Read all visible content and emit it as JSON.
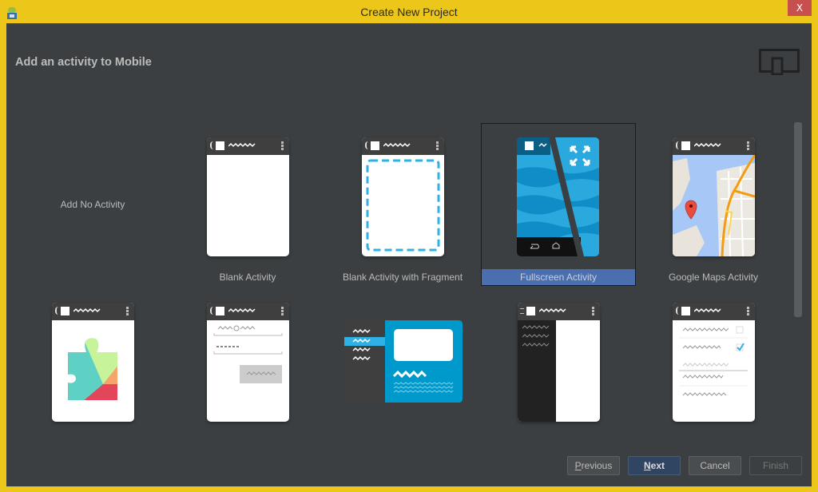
{
  "window": {
    "title": "Create New Project",
    "close_label": "X"
  },
  "page": {
    "heading": "Add an activity to Mobile",
    "device_icon": "phone-tablet-icon"
  },
  "activities": [
    {
      "label": "Add No Activity",
      "preview": "none",
      "selected": false
    },
    {
      "label": "Blank Activity",
      "preview": "blank",
      "selected": false
    },
    {
      "label": "Blank Activity with Fragment",
      "preview": "fragment",
      "selected": false
    },
    {
      "label": "Fullscreen Activity",
      "preview": "fullscreen",
      "selected": true
    },
    {
      "label": "Google Maps Activity",
      "preview": "maps",
      "selected": false
    },
    {
      "label": "",
      "preview": "play-services",
      "selected": false
    },
    {
      "label": "",
      "preview": "login",
      "selected": false
    },
    {
      "label": "",
      "preview": "master-detail",
      "selected": false
    },
    {
      "label": "",
      "preview": "navigation-drawer",
      "selected": false
    },
    {
      "label": "",
      "preview": "settings",
      "selected": false
    }
  ],
  "buttons": {
    "previous": {
      "label": "Previous",
      "mnemonic": "P",
      "rest": "revious",
      "enabled": true
    },
    "next": {
      "label": "Next",
      "mnemonic": "N",
      "rest": "ext",
      "enabled": true
    },
    "cancel": {
      "label": "Cancel",
      "enabled": true
    },
    "finish": {
      "label": "Finish",
      "enabled": false
    }
  },
  "colors": {
    "frame": "#ecc619",
    "background": "#3c3f41",
    "selection": "#4b6eaf",
    "close": "#c7504f",
    "accent_blue": "#2fb1e6"
  }
}
